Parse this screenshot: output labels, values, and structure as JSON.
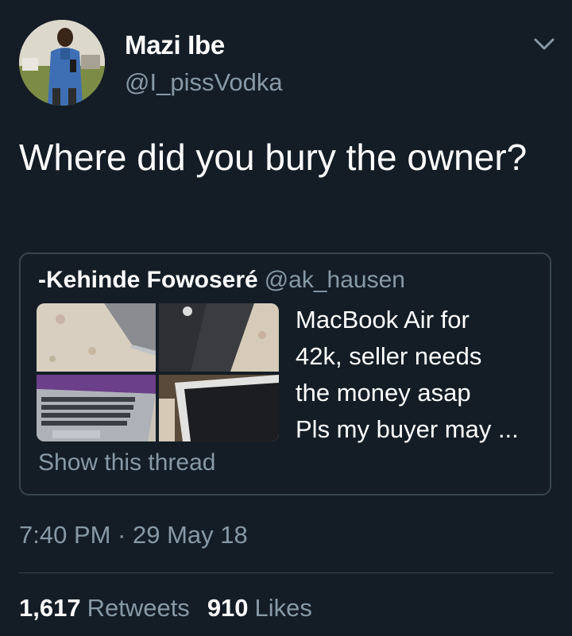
{
  "author": {
    "display_name": "Mazi Ibe",
    "handle": "@I_pissVodka"
  },
  "tweet": {
    "text": "Where did you bury the owner?"
  },
  "quoted_tweet": {
    "author_name": "-Kehinde Fowoseré",
    "author_handle": "@ak_hausen",
    "text": "MacBook Air for\n42k, seller needs\nthe money asap\nPls my buyer may ...",
    "show_thread_label": "Show this thread"
  },
  "meta": {
    "timestamp": "7:40 PM · 29 May 18"
  },
  "stats": {
    "retweets_count": "1,617",
    "retweets_label": "Retweets",
    "likes_count": "910",
    "likes_label": "Likes"
  },
  "icons": {
    "menu": "chevron-down-icon"
  },
  "colors": {
    "background": "#141d26",
    "secondary_text": "#8899a6",
    "border": "#38444d"
  }
}
